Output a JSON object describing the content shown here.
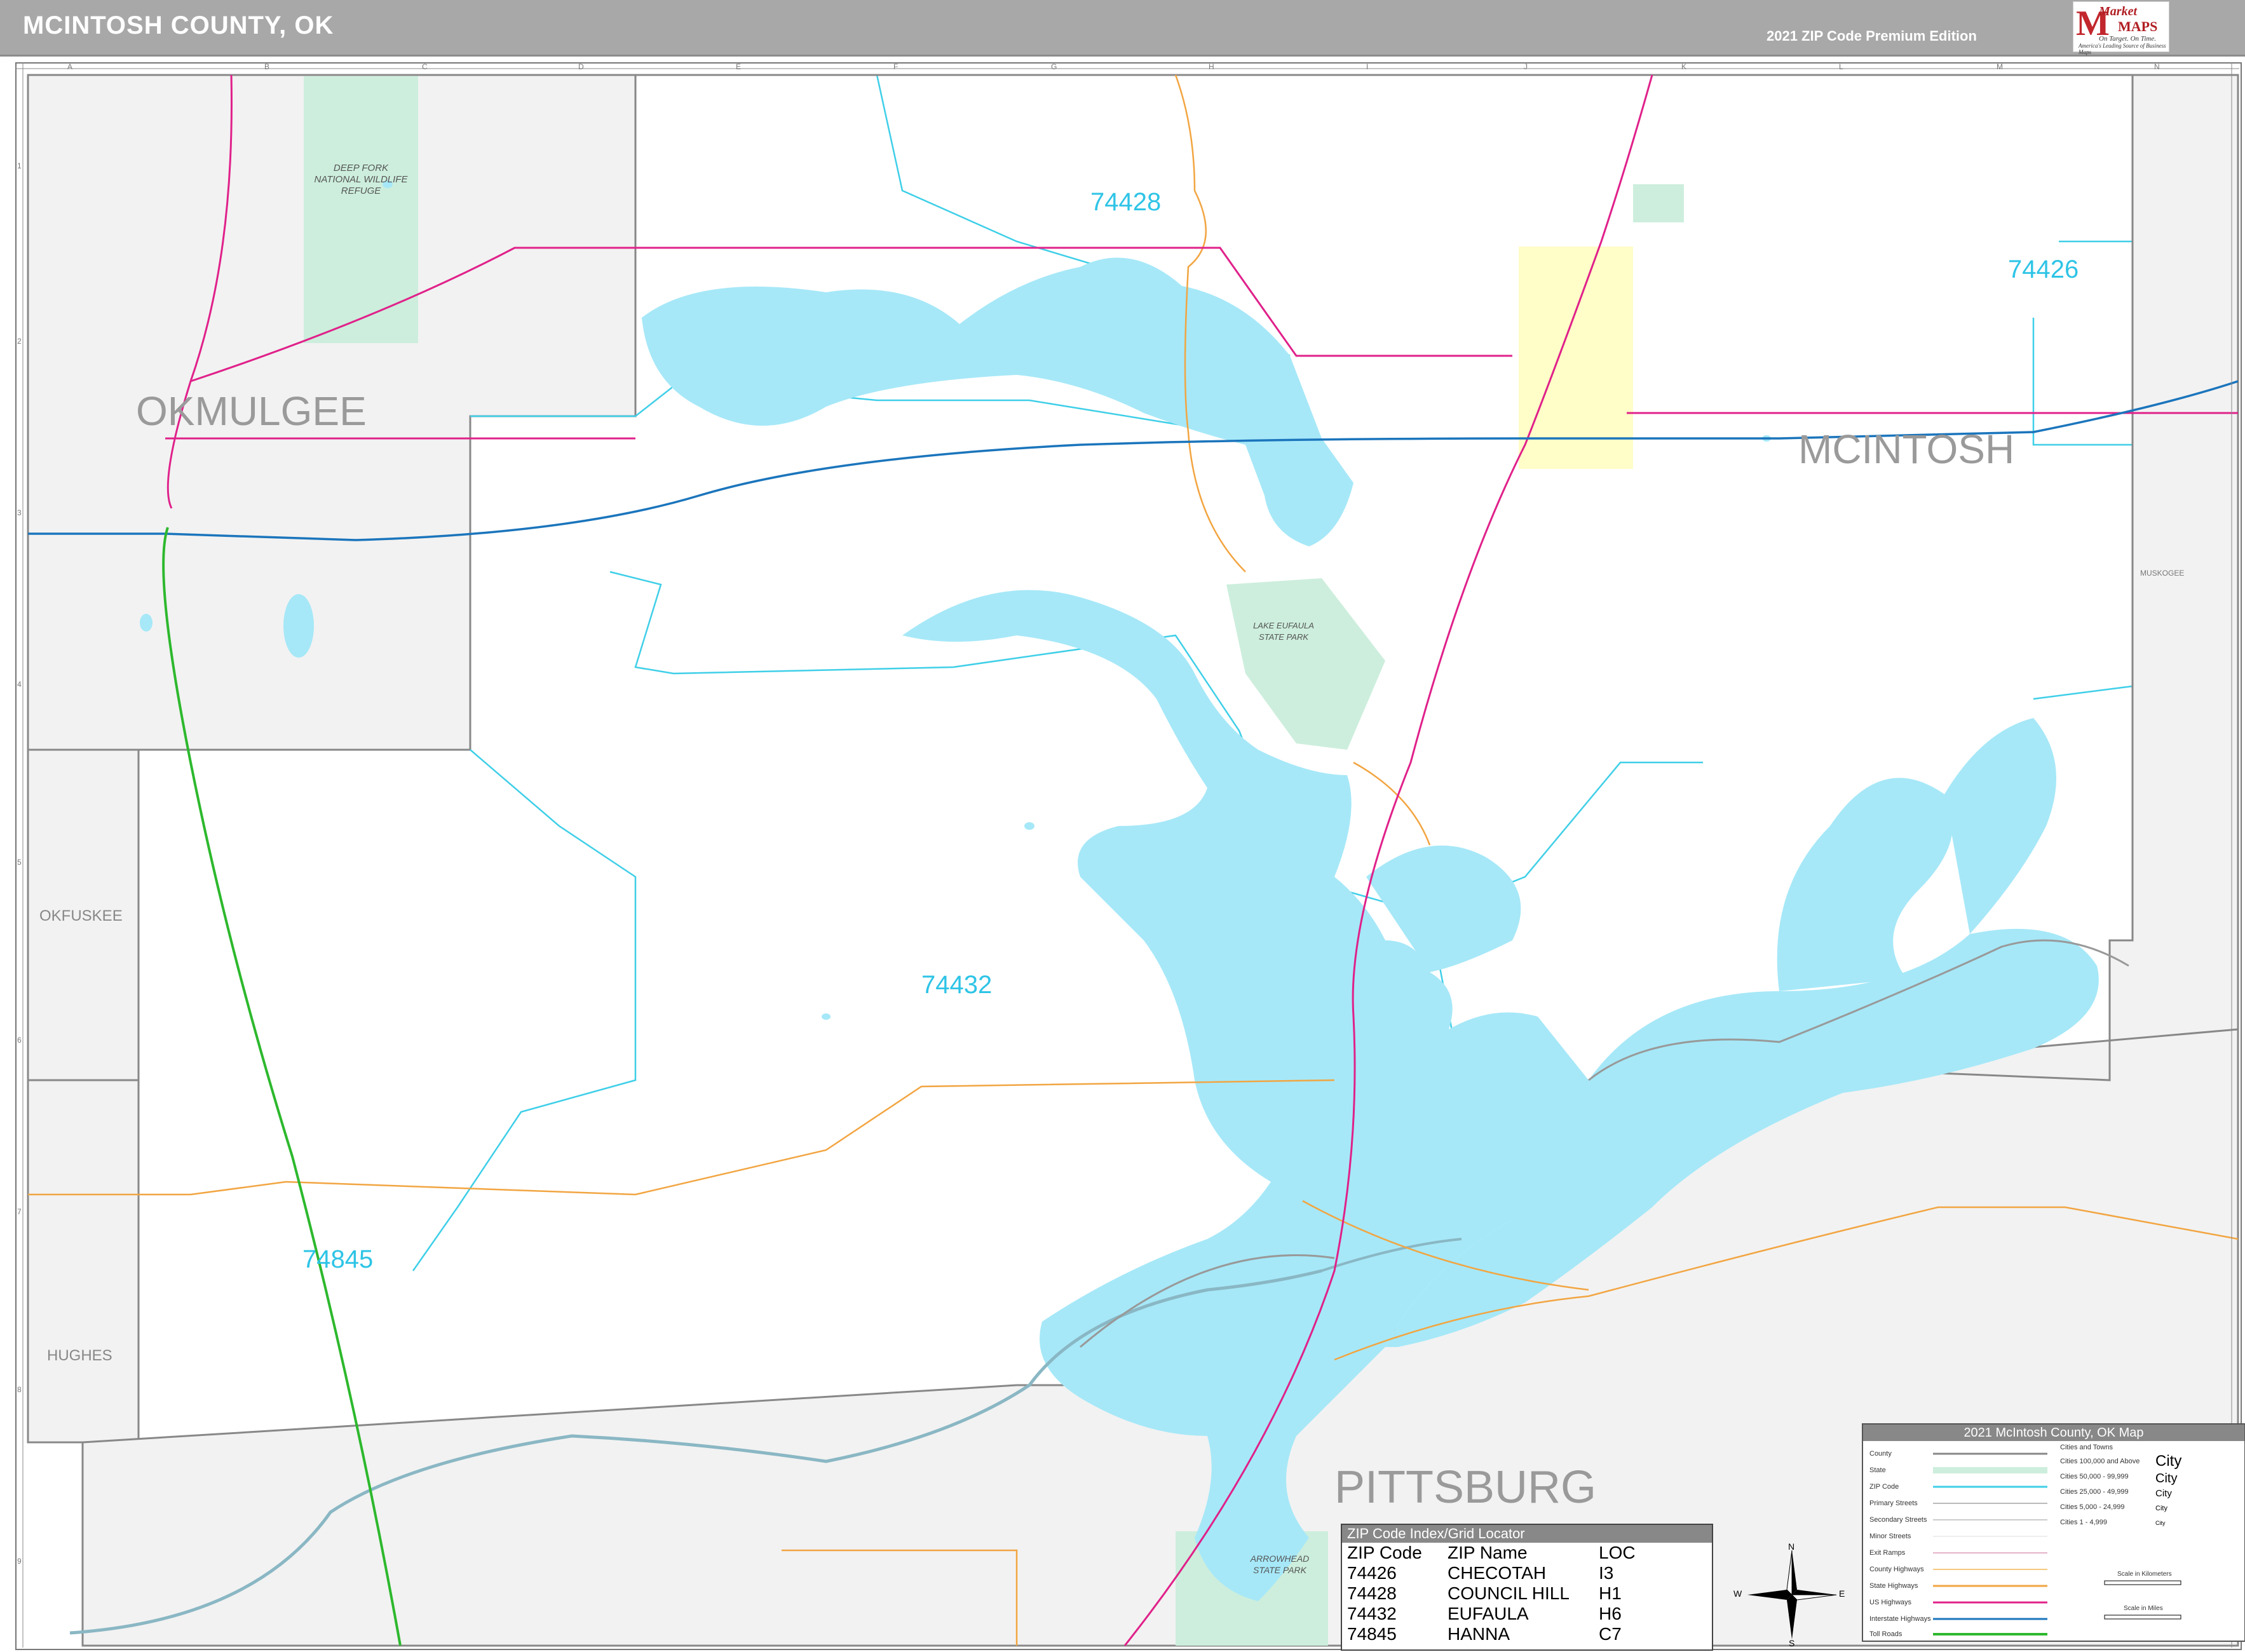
{
  "header": {
    "title": "MCINTOSH COUNTY, OK",
    "edition": "2021 ZIP Code Premium Edition"
  },
  "logo": {
    "brand_top": "Market",
    "brand_bottom": "MAPS",
    "tagline": "On Target. On Time.",
    "slogan": "America's Leading Source of Business Maps"
  },
  "colors": {
    "water": "#a6e8f8",
    "zip_label": "#2ec4e6",
    "interstate": "#1b75bc",
    "us_highway": "#e0218a",
    "toll_road": "#2db82d",
    "county_line": "#888888",
    "state_highway": "#f2a541",
    "park": "#cdeedd",
    "city_area": "#fffdc8"
  },
  "counties": {
    "okmulgee": "OKMULGEE",
    "mcintosh": "MCINTOSH",
    "pittsburg": "PITTSBURG",
    "okfuskee": "OKFUSKEE",
    "hughes": "HUGHES",
    "muskogee": "MUSKOGEE"
  },
  "zip_labels": [
    "74428",
    "74426",
    "74432",
    "74845"
  ],
  "places": {
    "refuge": "DEEP FORK NATIONAL WILDLIFE REFUGE",
    "lake_park": "LAKE EUFAULA STATE PARK",
    "arrowhead": "ARROWHEAD STATE PARK"
  },
  "grid_columns": [
    "A",
    "B",
    "C",
    "D",
    "E",
    "F",
    "G",
    "H",
    "I",
    "J",
    "K",
    "L",
    "M",
    "N"
  ],
  "grid_rows": [
    "1",
    "2",
    "3",
    "4",
    "5",
    "6",
    "7",
    "8",
    "9"
  ],
  "zip_index": {
    "title": "ZIP Code Index/Grid Locator",
    "headers": [
      "ZIP Code",
      "ZIP Name",
      "LOC"
    ],
    "rows": [
      [
        "74426",
        "CHECOTAH",
        "I3"
      ],
      [
        "74428",
        "COUNCIL HILL",
        "H1"
      ],
      [
        "74432",
        "EUFAULA",
        "H6"
      ],
      [
        "74845",
        "HANNA",
        "C7"
      ]
    ]
  },
  "legend": {
    "title": "2021 McIntosh County, OK Map",
    "items": [
      "County",
      "State",
      "ZIP Code",
      "Primary Streets",
      "Secondary Streets",
      "Minor Streets",
      "Exit Ramps",
      "County Highways",
      "State Highways",
      "US Highways",
      "Interstate Highways",
      "Toll Roads"
    ],
    "city_header": "Cities and Towns",
    "city_classes": [
      {
        "range": "Cities 100,000 and Above",
        "sample": "City"
      },
      {
        "range": "Cities 50,000 - 99,999",
        "sample": "City"
      },
      {
        "range": "Cities 25,000 - 49,999",
        "sample": "City"
      },
      {
        "range": "Cities 5,000 - 24,999",
        "sample": "City"
      },
      {
        "range": "Cities 1 - 4,999",
        "sample": "City"
      }
    ],
    "scale_km": "Scale in Kilometers",
    "scale_mi": "Scale in Miles"
  },
  "compass": {
    "n": "N",
    "s": "S",
    "e": "E",
    "w": "W"
  }
}
